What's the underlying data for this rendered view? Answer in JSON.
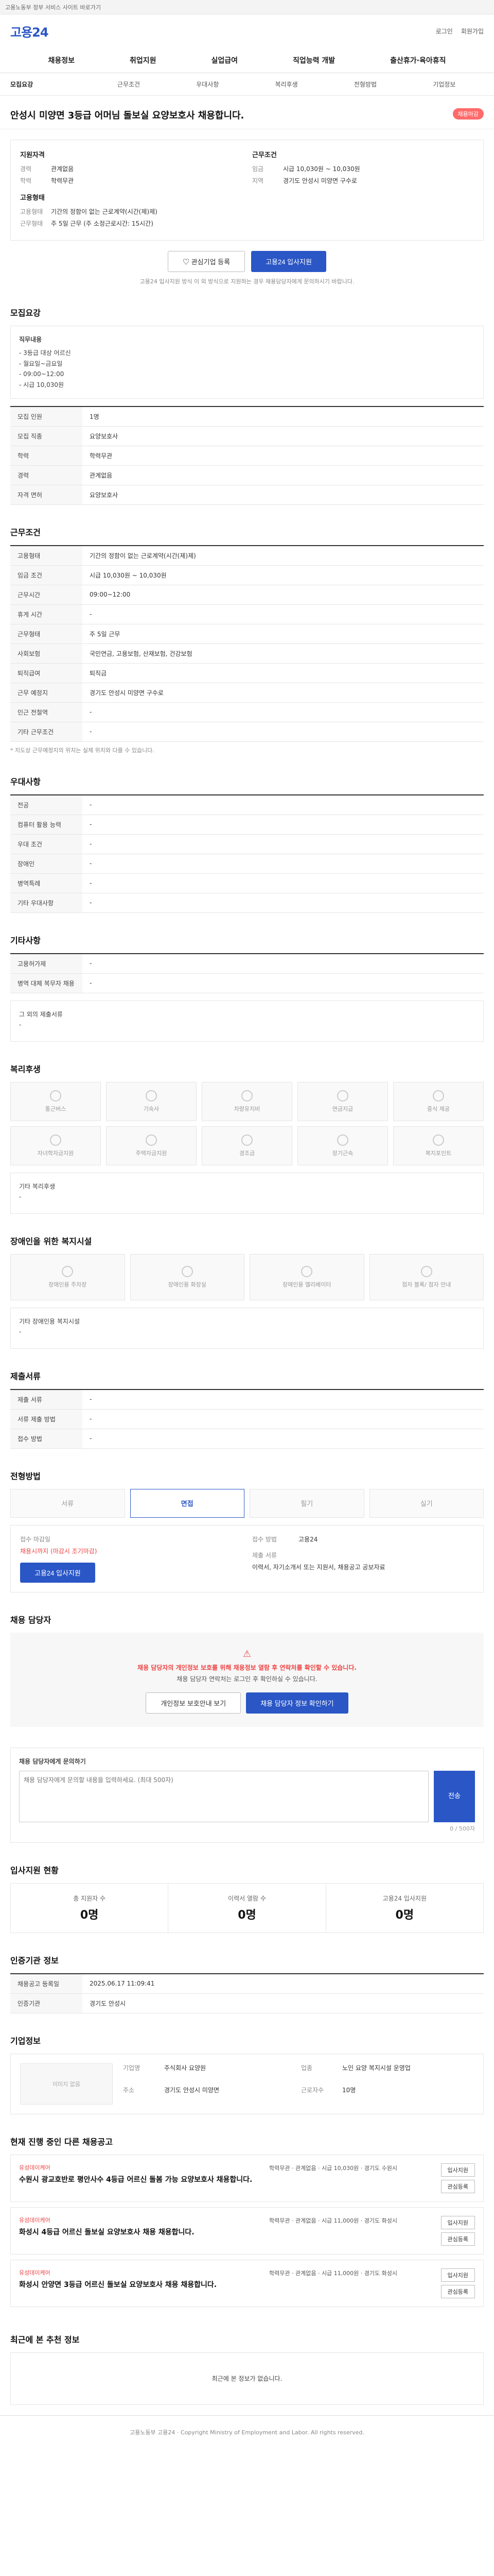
{
  "topbar": {
    "text": "고용노동부 정부 서비스 사이트 바로가기"
  },
  "header": {
    "logo": "고용24",
    "links": [
      "로그인",
      "회원가입"
    ]
  },
  "gnb": [
    "채용정보",
    "취업지원",
    "실업급여",
    "직업능력 개발",
    "출산휴가·육아휴직"
  ],
  "subnav": [
    "모집요강",
    "근무조건",
    "우대사항",
    "복리후생",
    "전형방법",
    "기업정보"
  ],
  "job": {
    "title": "안성시 미양면 3등급 어머님 돌보실 요양보호사 채용합니다.",
    "badge": "채용마감"
  },
  "summary": {
    "left_title": "지원자격",
    "left": [
      {
        "k": "경력",
        "v": "관계없음"
      },
      {
        "k": "학력",
        "v": "학력무관"
      }
    ],
    "right_title": "근무조건",
    "right": [
      {
        "k": "임금",
        "v": "시급 10,030원 ~ 10,030원"
      },
      {
        "k": "지역",
        "v": "경기도 안성시 미양면 구수로"
      }
    ],
    "mid_title": "고용형태",
    "mid": [
      {
        "k": "고용형태",
        "v": "기간의 정함이 없는 근로계약(시간(제)제)"
      },
      {
        "k": "근무형태",
        "v": "주 5일 근무 (주 소정근로시간: 15시간)"
      }
    ]
  },
  "actions": {
    "scrap": "관심기업 등록",
    "apply": "고용24 입사지원",
    "note": "고용24 입사지원 방식 이 외 방식으로 지원하는 경우 채용담당자에게 문의하시기 바랍니다."
  },
  "recruit": {
    "title": "모집요강",
    "job_desc_title": "직무내용",
    "job_desc": "- 3등급 대상 어르신\n- 월요일~금요일\n- 09:00~12:00\n- 시급 10,030원",
    "rows": [
      {
        "k": "모집 인원",
        "v": "1명"
      },
      {
        "k": "모집 직종",
        "v": "요양보호사"
      },
      {
        "k": "학력",
        "v": "학력무관"
      },
      {
        "k": "경력",
        "v": "관계없음"
      },
      {
        "k": "자격 면허",
        "v": "요양보호사"
      }
    ]
  },
  "condition": {
    "title": "근무조건",
    "rows": [
      {
        "k": "고용형태",
        "v": "기간의 정함이 없는 근로계약(시간(제)제)"
      },
      {
        "k": "임금 조건",
        "v": "시급 10,030원 ~ 10,030원"
      },
      {
        "k": "근무시간",
        "v": "09:00~12:00"
      },
      {
        "k": "휴게 시간",
        "v": "-"
      },
      {
        "k": "근무형태",
        "v": "주 5일 근무"
      },
      {
        "k": "사회보험",
        "v": "국민연금, 고용보험, 산재보험, 건강보험"
      },
      {
        "k": "퇴직급여",
        "v": "퇴직금"
      },
      {
        "k": "근무 예정지",
        "v": "경기도 안성시 미양면 구수로"
      },
      {
        "k": "인근 전철역",
        "v": "-"
      },
      {
        "k": "기타 근무조건",
        "v": "-"
      }
    ],
    "note": "* 지도상 근무예정지의 위치는 실제 위치와 다를 수 있습니다."
  },
  "prefer": {
    "title": "우대사항",
    "rows": [
      {
        "k": "전공",
        "v": "-"
      },
      {
        "k": "컴퓨터 활용 능력",
        "v": "-"
      },
      {
        "k": "우대 조건",
        "v": "-"
      },
      {
        "k": "장애인",
        "v": "-"
      },
      {
        "k": "병역특례",
        "v": "-"
      },
      {
        "k": "기타 우대사항",
        "v": "-"
      }
    ]
  },
  "extra": {
    "title": "기타사항",
    "rows": [
      {
        "k": "고용허가제",
        "v": "-"
      },
      {
        "k": "병역 대체 복무자 채용",
        "v": "-"
      }
    ],
    "box_title": "그 외의 제출서류",
    "box": "-"
  },
  "welfare": {
    "title": "복리후생",
    "items": [
      "통근버스",
      "기숙사",
      "차량유지비",
      "연금지급",
      "중식 제공",
      "자녀학자금지원",
      "주택자금지원",
      "경조금",
      "장기근속",
      "복지포인트"
    ],
    "etc_title": "기타 복리후생",
    "etc": "-"
  },
  "disabled": {
    "title": "장애인을 위한 복지시설",
    "items": [
      "장애인용 주차장",
      "장애인용 화장실",
      "장애인용 엘리베이터",
      "점자 블록/ 점자 안내"
    ],
    "etc_title": "기타 장애인용 복지시설",
    "etc": "-"
  },
  "documents": {
    "title": "제출서류",
    "rows": [
      {
        "k": "제출 서류",
        "v": "-"
      },
      {
        "k": "서류 제출 방법",
        "v": "-"
      },
      {
        "k": "접수 방법",
        "v": "-"
      }
    ]
  },
  "process": {
    "title": "전형방법",
    "steps": [
      "서류",
      "면접",
      "필기",
      "실기"
    ],
    "deadline_label": "접수 마감일",
    "deadline": "채용시까지 (마감시 조기마감)",
    "method_label": "접수 방법",
    "method": "고용24",
    "apply": "고용24 입사지원",
    "doc_label": "제출 서류",
    "doc": "이력서, 자기소개서 또는 지원서, 채용공고 공보자료"
  },
  "contact": {
    "title": "채용 담당자",
    "alert_line1": "채용 담당자의 개인정보 보호를 위해 채용정보 열람 후 연락처를 확인할 수 있습니다.",
    "alert_line2": "채용 담당자 연락처는 로그인 후 확인하실 수 있습니다.",
    "btn1": "개인정보 보호안내 보기",
    "btn2": "채용 담당자 정보 확인하기"
  },
  "inquiry": {
    "title": "채용 담당자에게 문의하기",
    "placeholder": "채용 담당자에게 문의할 내용을 입력하세요. (최대 500자)",
    "counter": "0 / 500자",
    "send": "전송"
  },
  "status": {
    "title": "입사지원 현황",
    "items": [
      {
        "l": "총 지원자 수",
        "n": "0명"
      },
      {
        "l": "이력서 열람 수",
        "n": "0명"
      },
      {
        "l": "고용24 입사지원",
        "n": "0명"
      }
    ]
  },
  "manage": {
    "title": "인증기관 정보",
    "rows": [
      {
        "k": "채용공고 등록일",
        "v": "2025.06.17 11:09:41"
      },
      {
        "k": "인증기관",
        "v": "경기도 안성시"
      }
    ]
  },
  "company": {
    "title": "기업정보",
    "logo": "이미지 없음",
    "rows": [
      {
        "k": "기업명",
        "v": "주식회사 요양원"
      },
      {
        "k": "업종",
        "v": "노인 요양 복지시설 운영업"
      },
      {
        "k": "주소",
        "v": "경기도 안성시 미양면"
      },
      {
        "k": "근로자수",
        "v": "10명"
      }
    ]
  },
  "related": {
    "title": "현재 진행 중인 다른 채용공고",
    "items": [
      {
        "company": "유성데이케어",
        "title": "수원시 광교호반로 평안사수 4등급 어르신 돌봄 가능 요양보호사 채용합니다.",
        "info": "학력무관 · 관계없음 · 시급 10,030원 · 경기도 수원시"
      },
      {
        "company": "유성데이케어",
        "title": "화성시 4등급 어르신 돌보실 요양보호사 채용 채용합니다.",
        "info": "학력무관 · 관계없음 · 시급 11,000원 · 경기도 화성시"
      },
      {
        "company": "유성데이케어",
        "title": "화성시 안양면 3등급 어르신 돌보실 요양보호사 채용 채용합니다.",
        "info": "학력무관 · 관계없음 · 시급 11,000원 · 경기도 화성시"
      }
    ],
    "apply": "입사지원",
    "scrap": "관심등록"
  },
  "recent": {
    "title": "최근에 본 추천 정보",
    "empty": "최근에 본 정보가 없습니다."
  },
  "footer": {
    "text": "고용노동부 고용24 · Copyright Ministry of Employment and Labor. All rights reserved."
  }
}
